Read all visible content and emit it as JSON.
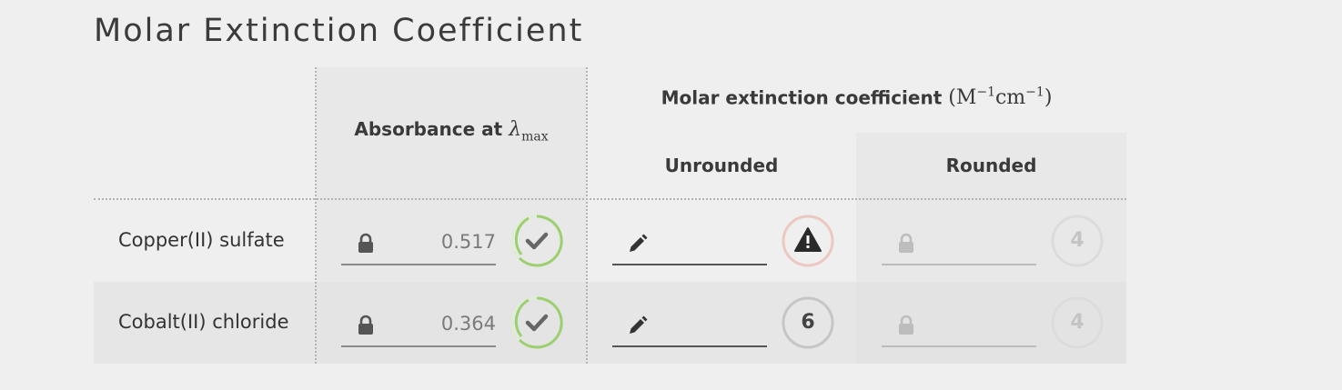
{
  "page_title": "Molar Extinction Coefficient",
  "headers": {
    "absorbance_prefix": "Absorbance at ",
    "lambda": "λ",
    "lambda_sub": "max",
    "molar_prefix": "Molar extinction coefficient ",
    "unit_open": "(M",
    "unit_sup1": "−1",
    "unit_mid": "cm",
    "unit_sup2": "−1",
    "unit_close": ")",
    "unrounded": "Unrounded",
    "rounded": "Rounded"
  },
  "rows": [
    {
      "label": "Copper(II) sulfate",
      "absorbance": "0.517",
      "absorbance_status": "check-icon",
      "unrounded_value": "",
      "unrounded_status": "warning-icon",
      "rounded_value": "",
      "rounded_badge": "4"
    },
    {
      "label": "Cobalt(II) chloride",
      "absorbance": "0.364",
      "absorbance_status": "check-icon",
      "unrounded_value": "",
      "unrounded_badge": "6",
      "rounded_value": "",
      "rounded_badge": "4"
    }
  ],
  "colors": {
    "background": "#efefef",
    "shaded": "#e6e6e6",
    "shaded_light": "#eaeaea",
    "success": "#9ccf70",
    "warning_ring": "#ecc8c0",
    "neutral_ring": "#c6c6c6",
    "disabled_ring": "#dcdcdc"
  }
}
